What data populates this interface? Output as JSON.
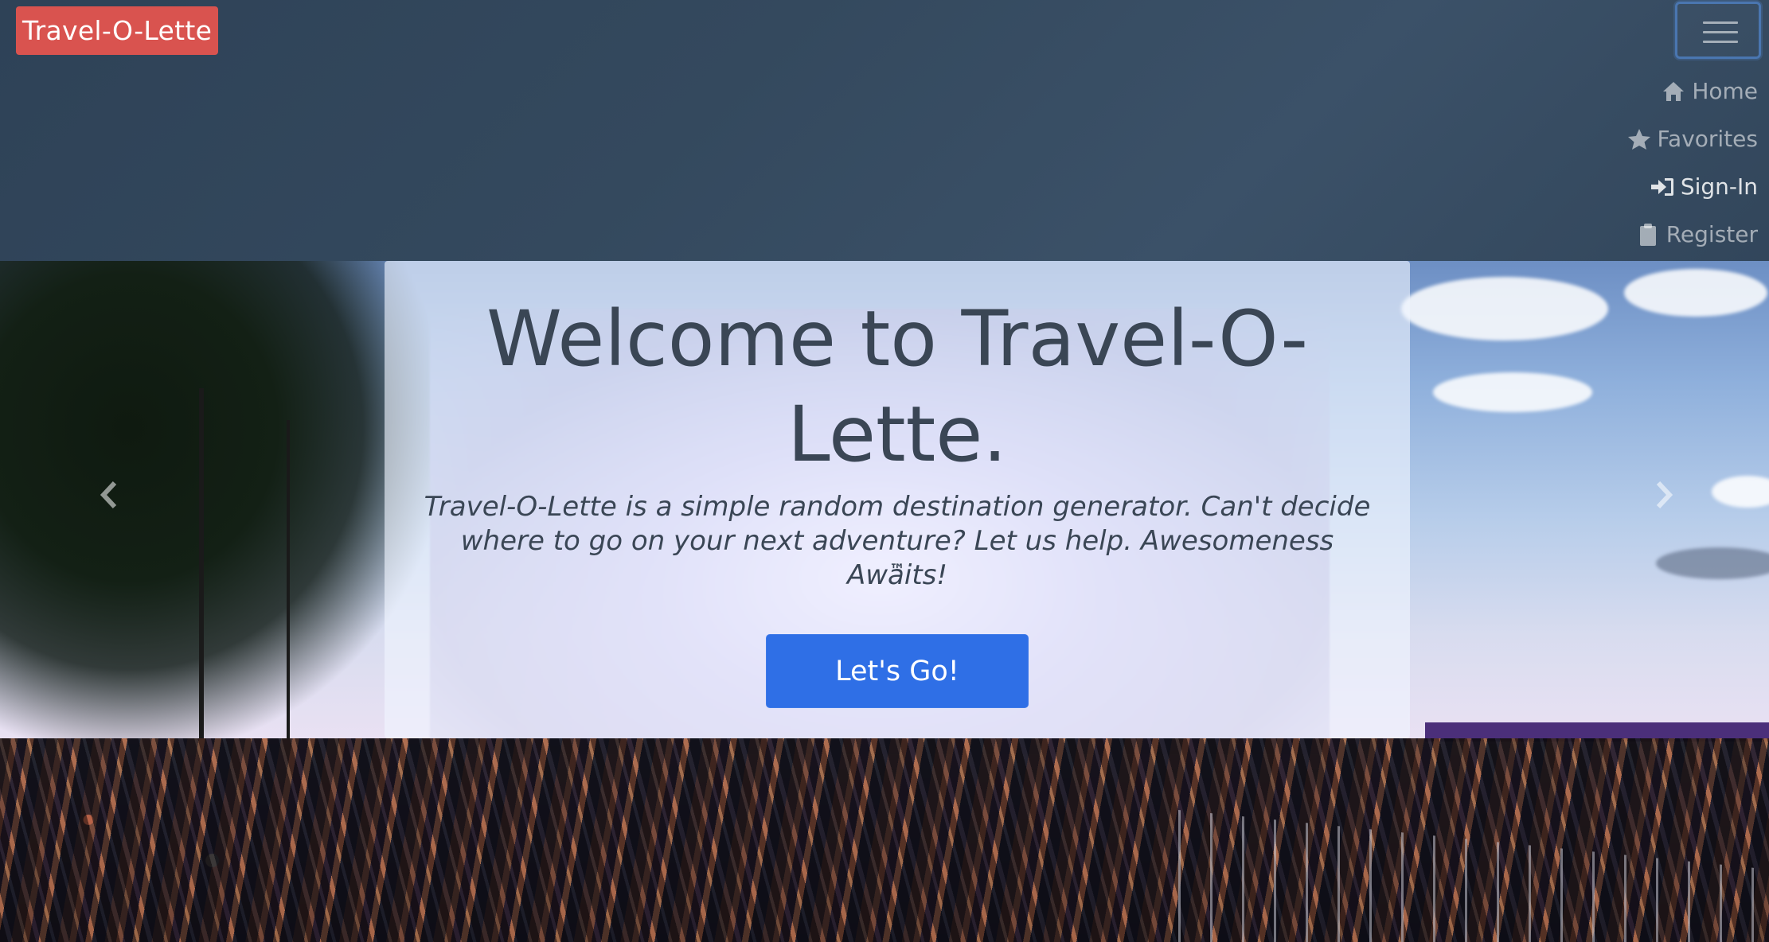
{
  "navbar": {
    "brand": "Travel-O-Lette",
    "links": [
      {
        "label": "Home",
        "icon": "home-icon"
      },
      {
        "label": "Favorites",
        "icon": "star-icon"
      },
      {
        "label": "Sign-In",
        "icon": "sign-in-icon"
      },
      {
        "label": "Register",
        "icon": "clipboard-icon"
      }
    ],
    "toggler_icon": "hamburger-icon"
  },
  "hero": {
    "title": "Welcome to Travel-O-Lette.",
    "lead": "Travel-O-Lette is a simple random destination generator. Can't decide where to go on your next adventure? Let us help. Awesomeness Awaits!",
    "trademark": "™",
    "cta_label": "Let's Go!",
    "prev_icon": "chevron-left-icon",
    "next_icon": "chevron-right-icon"
  },
  "colors": {
    "navbar": "#34495e",
    "brand_bg": "#d9534f",
    "cta_bg": "#2f6fe6",
    "heading_text": "#3a4655"
  }
}
